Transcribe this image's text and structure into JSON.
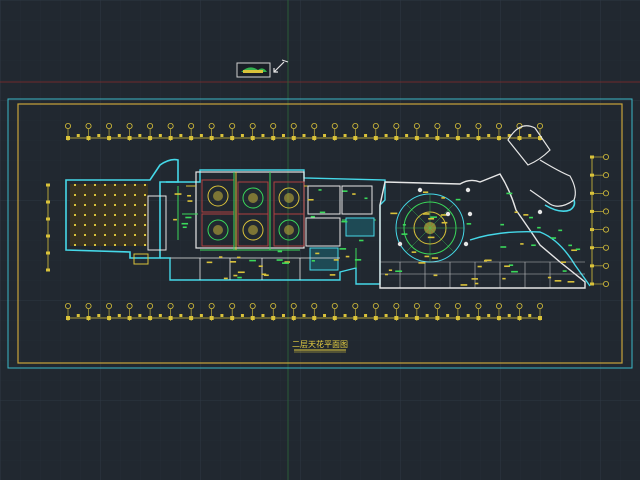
{
  "drawing": {
    "title": "二层天花平面图",
    "colors": {
      "background": "#212830",
      "grid": "#2c3540",
      "axis_red": "#8a2b2b",
      "axis_green": "#2d6a3a",
      "frame_yellow": "#c8a43a",
      "frame_cyan": "#3ab8c8",
      "wall_white": "#e6e6e6",
      "accent_cyan": "#45d8e8",
      "fixture_yellow": "#d9c23a",
      "highlight_green": "#3ad85a",
      "ceiling_red": "#b04040"
    },
    "icons": [
      "layout-thumbnail-icon",
      "pen-cursor-icon"
    ],
    "dimension_ticks_top": 24,
    "dimension_ticks_bottom": 24,
    "dimension_ticks_right": 8,
    "dimension_ticks_left": 6
  }
}
